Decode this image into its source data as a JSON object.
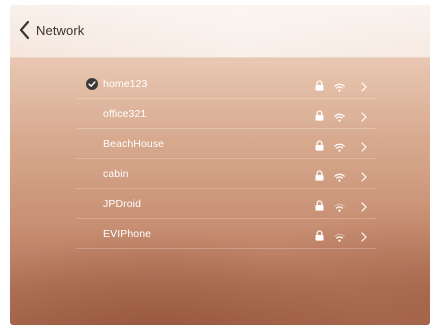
{
  "header": {
    "title": "Network"
  },
  "networks": [
    {
      "name": "home123",
      "connected": true,
      "secured": true,
      "signal": "strong"
    },
    {
      "name": "office321",
      "connected": false,
      "secured": true,
      "signal": "strong"
    },
    {
      "name": "BeachHouse",
      "connected": false,
      "secured": true,
      "signal": "strong"
    },
    {
      "name": "cabin",
      "connected": false,
      "secured": true,
      "signal": "strong"
    },
    {
      "name": "JPDroid",
      "connected": false,
      "secured": true,
      "signal": "medium"
    },
    {
      "name": "EVIPhone",
      "connected": false,
      "secured": true,
      "signal": "medium"
    }
  ],
  "icons": {
    "back": "chevron-left-icon",
    "connected": "checkmark-circle-icon",
    "secured": "lock-icon",
    "signal": "wifi-icon",
    "details": "chevron-right-icon"
  },
  "colors": {
    "header_text": "#3a3633",
    "row_text": "#ffffff",
    "row_icons": "#ffffff",
    "check_fill": "#3d3935"
  }
}
